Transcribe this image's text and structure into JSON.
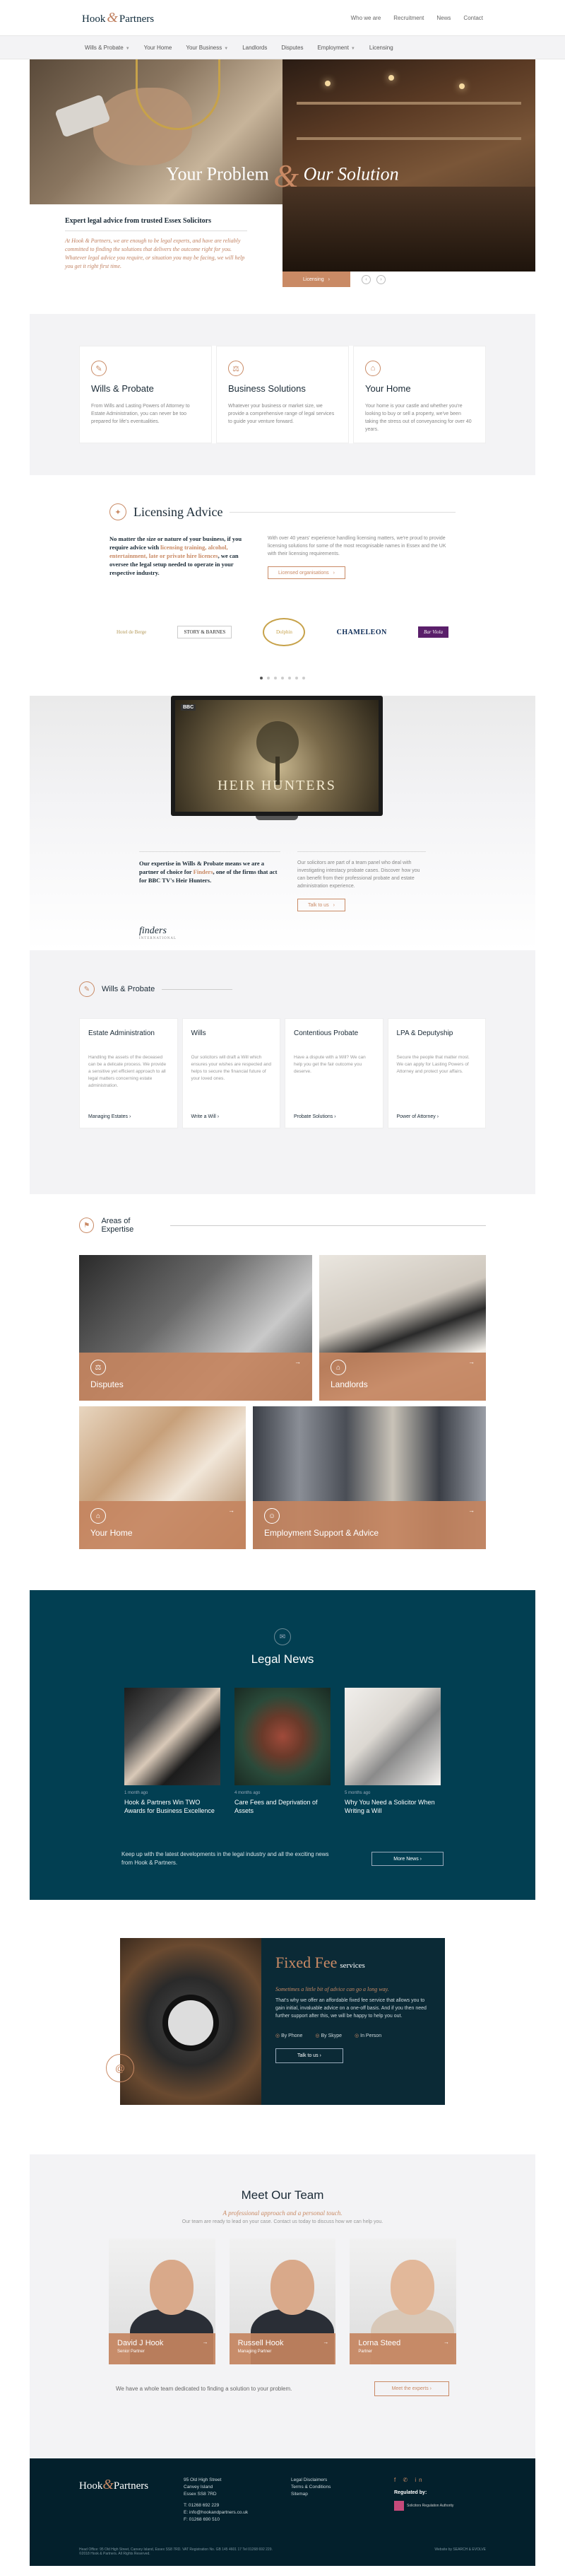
{
  "header": {
    "logo_main": "Hook",
    "logo_amp": "&",
    "logo_sub": "Partners",
    "links": [
      "Who we are",
      "Recruitment",
      "News",
      "Contact"
    ]
  },
  "nav": {
    "items": [
      {
        "label": "Wills & Probate",
        "dropdown": true
      },
      {
        "label": "Your Home",
        "dropdown": false
      },
      {
        "label": "Your Business",
        "dropdown": true
      },
      {
        "label": "Landlords",
        "dropdown": false
      },
      {
        "label": "Disputes",
        "dropdown": false
      },
      {
        "label": "Employment",
        "dropdown": true
      },
      {
        "label": "Licensing",
        "dropdown": false
      }
    ]
  },
  "hero": {
    "title_left": "Your Problem",
    "amp": "&",
    "title_right": "Our Solution",
    "card_title": "Expert legal advice from trusted Essex Solicitors",
    "card_text": "At Hook & Partners, we are enough to be legal experts, and have are reliably committed to finding the solutions that delivers the outcome right for you. Whatever legal advice you require, or situation you may be facing, we will help you get it right first time.",
    "button_label": "Licensing",
    "prev": "‹",
    "next": "›"
  },
  "services": [
    {
      "icon": "✎",
      "title": "Wills & Probate",
      "text": "From Wills and Lasting Powers of Attorney to Estate Administration, you can never be too prepared for life's eventualities."
    },
    {
      "icon": "⚖",
      "title": "Business Solutions",
      "text": "Whatever your business or market size, we provide a comprehensive range of legal services to guide your venture forward."
    },
    {
      "icon": "⌂",
      "title": "Your Home",
      "text": "Your home is your castle and whether you're looking to buy or sell a property, we've been taking the stress out of conveyancing for over 40 years."
    }
  ],
  "licensing": {
    "icon": "✦",
    "title": "Licensing Advice",
    "left_a": "No matter the size or nature of your business, if you require advice with ",
    "left_hl": "licensing training, alcohol, entertainment, late or private hire licences",
    "left_b": ", we can oversee the legal setup needed to operate in your respective industry.",
    "right": "With over 40 years' experience handling licensing matters, we're proud to provide licensing solutions for some of the most recognisable names in Essex and the UK with their licensing requirements.",
    "button": "Licensed organisations",
    "logos": [
      "Hotel de Berge",
      "STORY & BARNES",
      "Dolphin",
      "CHAMELEON",
      "Bar Viola"
    ]
  },
  "hunters": {
    "bbc": "BBC",
    "show_title": "HEIR HUNTERS",
    "left_a": "Our expertise in Wills & Probate means we are a partner of choice for ",
    "left_hl": "Finders",
    "left_b": ", one of the firms that act for BBC TV's Heir Hunters.",
    "right": "Our solicitors are part of a team panel who deal with investigating intestacy probate cases. Discover how you can benefit from their professional probate and estate administration experience.",
    "button": "Talk to us",
    "finders": "finders",
    "finders_sub": "INTERNATIONAL"
  },
  "wills": {
    "icon": "✎",
    "title": "Wills & Probate",
    "items": [
      {
        "title": "Estate Administration",
        "text": "Handling the assets of the deceased can be a delicate process. We provide a sensitive yet efficient approach to all legal matters concerning estate administration.",
        "link": "Managing Estates"
      },
      {
        "title": "Wills",
        "text": "Our solicitors will draft a Will which ensures your wishes are respected and helps to secure the financial future of your loved ones.",
        "link": "Write a Will"
      },
      {
        "title": "Contentious Probate",
        "text": "Have a dispute with a Will? We can help you get the fair outcome you deserve.",
        "link": "Probate Solutions"
      },
      {
        "title": "LPA & Deputyship",
        "text": "Secure the people that matter most. We can apply for Lasting Powers of Attorney and protect your affairs.",
        "link": "Power of Attorney"
      }
    ]
  },
  "areas": {
    "icon": "⚑",
    "title": "Areas of Expertise",
    "tiles": [
      {
        "label": "Disputes",
        "icon": "⚖"
      },
      {
        "label": "Landlords",
        "icon": "⌂"
      },
      {
        "label": "Your Home",
        "icon": "⌂"
      },
      {
        "label": "Employment Support & Advice",
        "icon": "☺"
      }
    ],
    "arrow": "→"
  },
  "news": {
    "icon": "✉",
    "title": "Legal News",
    "articles": [
      {
        "date": "1 month ago",
        "title": "Hook & Partners Win TWO Awards for Business Excellence"
      },
      {
        "date": "4 months ago",
        "title": "Care Fees and Deprivation of Assets"
      },
      {
        "date": "5 months ago",
        "title": "Why You Need a Solicitor When Writing a Will"
      }
    ],
    "foot_text": "Keep up with the latest developments in the legal industry and all the exciting news from Hook & Partners.",
    "button": "More News"
  },
  "fixed": {
    "title": "Fixed Fee",
    "title_small": "services",
    "sub": "Sometimes a little bit of advice can go a long way.",
    "text": "That's why we offer an affordable fixed fee service that allows you to gain initial, invaluable advice on a one-off basis. And if you then need further support after this, we will be happy to help you out.",
    "options": [
      "By Phone",
      "By Skype",
      "In Person"
    ],
    "button": "Talk to us",
    "circle": "@"
  },
  "team": {
    "title": "Meet Our Team",
    "tag": "A professional approach and a personal touch.",
    "sub": "Our team are ready to lead on your case. Contact us today to discuss how we can help you.",
    "members": [
      {
        "name": "David J Hook",
        "role": "Senior Partner"
      },
      {
        "name": "Russell Hook",
        "role": "Managing Partner"
      },
      {
        "name": "Lorna Steed",
        "role": "Partner"
      }
    ],
    "foot_text": "We have a whole team dedicated to finding a solution to your problem.",
    "button": "Meet the experts"
  },
  "footer": {
    "address": [
      "95 Old High Street",
      "Canvey Island",
      "Essex SS8 7RD"
    ],
    "phones": [
      "T: 01268 692 229",
      "E: info@hookandpartners.co.uk",
      "F: 01268 690 510"
    ],
    "links": [
      "Legal Disclaimers",
      "Terms & Conditions",
      "Sitemap"
    ],
    "social": "f ✆ in",
    "regulated": "Regulated by:",
    "sra": "Solicitors Regulation Authority",
    "legal": "Head Office: 95 Old High Street, Canvey Island, Essex SS8 7RD. VAT Registration No. GB 145 4601 17 Tel 01268 692 229.",
    "copyright": "©2018 Hook & Partners. All Rights Reserved.",
    "credit": "Website by SEARCH & EVOLVE"
  }
}
